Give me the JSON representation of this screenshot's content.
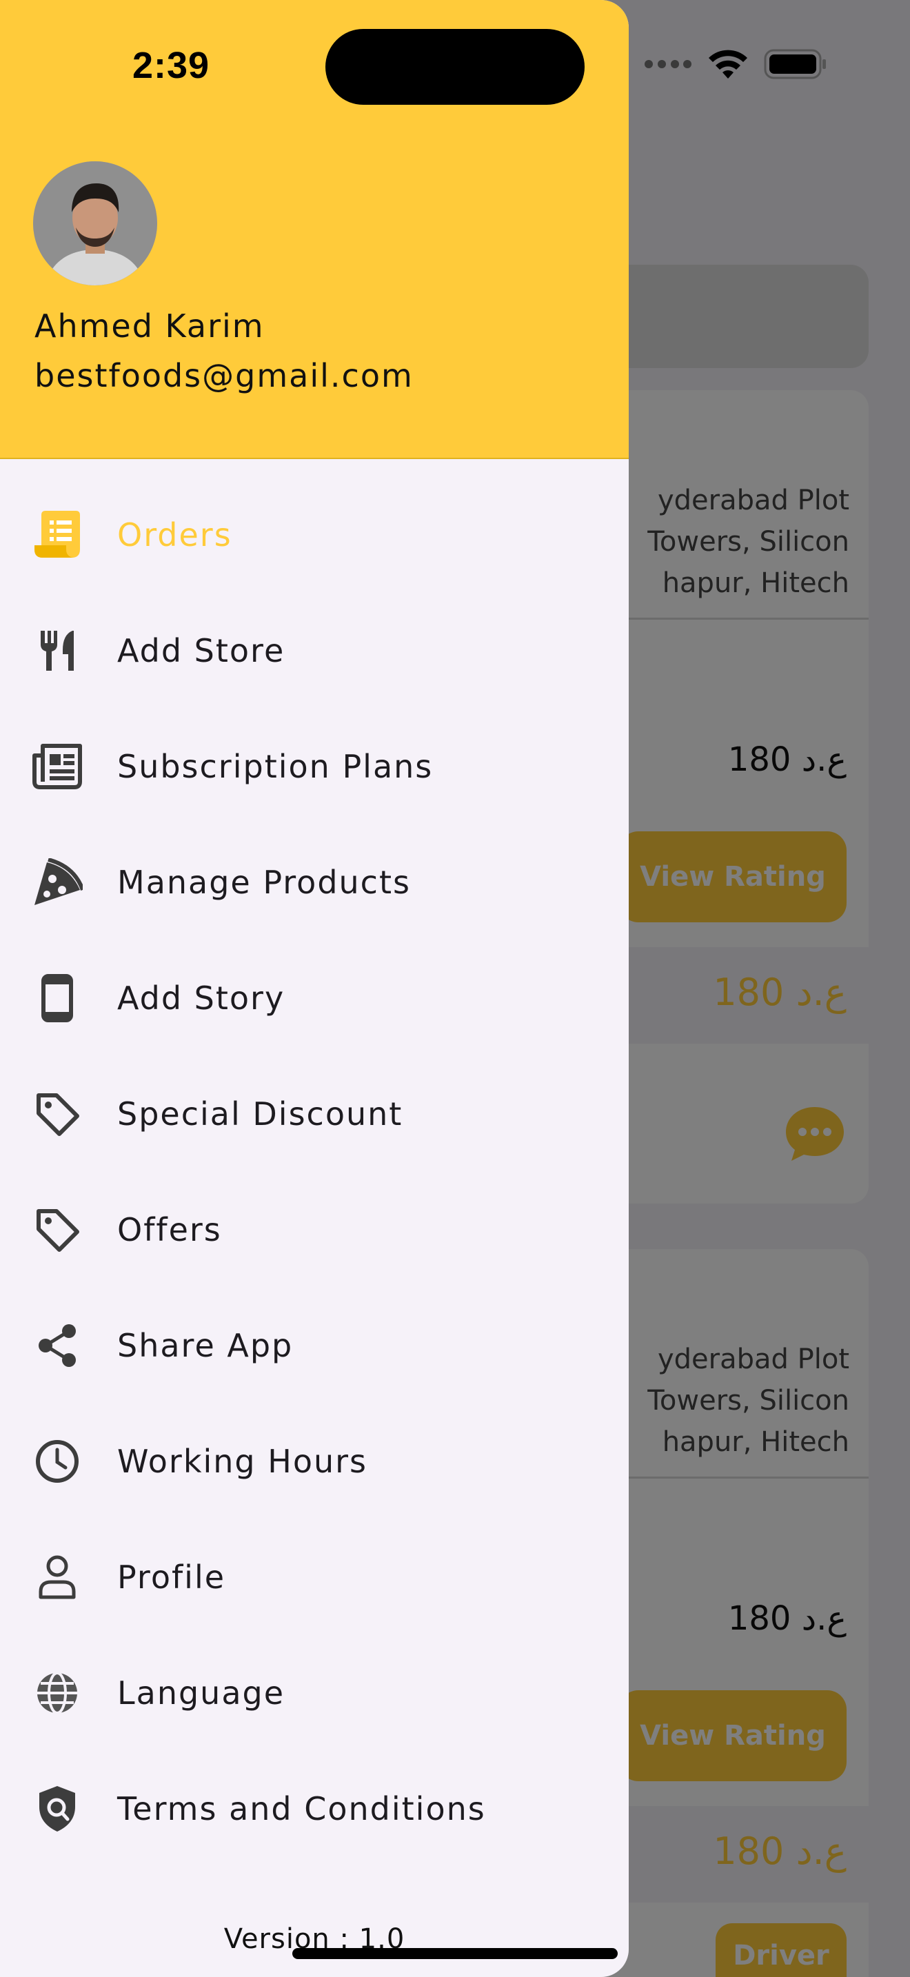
{
  "status_bar": {
    "time": "2:39"
  },
  "colors": {
    "accent": "#ffcb3a",
    "drawer_bg": "#f6f2f9",
    "text": "#1d1b20"
  },
  "user": {
    "name": "Ahmed Karim",
    "email": "bestfoods@gmail.com"
  },
  "menu": {
    "items": [
      {
        "label": "Orders",
        "icon": "orders-receipt-icon",
        "active": true
      },
      {
        "label": "Add Store",
        "icon": "fork-knife-icon"
      },
      {
        "label": "Subscription Plans",
        "icon": "newspaper-icon"
      },
      {
        "label": "Manage Products",
        "icon": "pizza-icon"
      },
      {
        "label": "Add Story",
        "icon": "phone-icon"
      },
      {
        "label": "Special Discount",
        "icon": "tag-icon"
      },
      {
        "label": "Offers",
        "icon": "tag-icon"
      },
      {
        "label": "Share App",
        "icon": "share-icon"
      },
      {
        "label": "Working Hours",
        "icon": "clock-icon"
      },
      {
        "label": "Profile",
        "icon": "person-icon"
      },
      {
        "label": "Language",
        "icon": "globe-icon"
      },
      {
        "label": "Terms and Conditions",
        "icon": "shield-search-icon"
      }
    ]
  },
  "footer": {
    "version": "Version : 1.0"
  },
  "background": {
    "cards": [
      {
        "address_lines": [
          "yderabad  Plot",
          "Towers, Silicon",
          "hapur, Hitech"
        ],
        "price": "180 ع.د",
        "view_rating": "View Rating",
        "total": "180 ع.د"
      },
      {
        "address_lines": [
          "yderabad  Plot",
          "Towers, Silicon",
          "hapur, Hitech"
        ],
        "price": "180 ع.د",
        "view_rating": "View Rating",
        "total": "180 ع.د",
        "driver": "Driver"
      }
    ]
  }
}
